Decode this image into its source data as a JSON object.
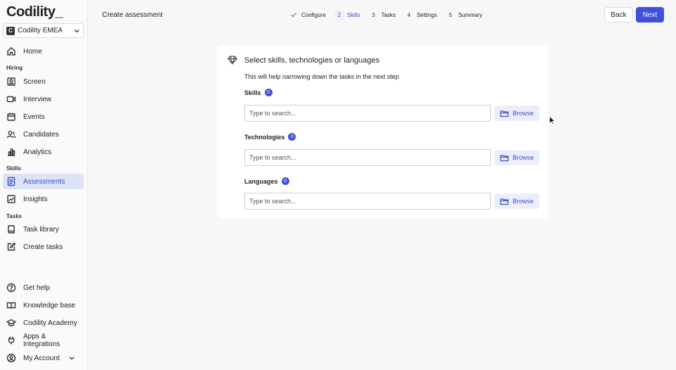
{
  "app": {
    "logo_text": "Codility_"
  },
  "org": {
    "badge": "C",
    "name": "Codility EMEA"
  },
  "nav": {
    "home": "Home",
    "hiring_label": "Hiring",
    "hiring": [
      "Screen",
      "Interview",
      "Events",
      "Candidates",
      "Analytics"
    ],
    "skills_label": "Skills",
    "skills": [
      "Assessments",
      "Insights"
    ],
    "tasks_label": "Tasks",
    "tasks": [
      "Task library",
      "Create tasks"
    ],
    "bottom": [
      "Get help",
      "Knowledge base",
      "Codility Academy",
      "Apps & Integrations",
      "My Account"
    ]
  },
  "header": {
    "title": "Create assessment",
    "steps": [
      {
        "num": "",
        "label": "Configure",
        "state": "done"
      },
      {
        "num": "2",
        "label": "Skills",
        "state": "current"
      },
      {
        "num": "3",
        "label": "Tasks",
        "state": "todo"
      },
      {
        "num": "4",
        "label": "Settings",
        "state": "todo"
      },
      {
        "num": "5",
        "label": "Summary",
        "state": "todo"
      }
    ],
    "back_label": "Back",
    "next_label": "Next"
  },
  "card": {
    "title": "Select skills, technologies or languages",
    "subtitle": "This will help narrowing down the tasks in the next step",
    "fields": [
      {
        "label": "Skills",
        "count": "0",
        "placeholder": "Type to search...",
        "browse_label": "Browse"
      },
      {
        "label": "Technologies",
        "count": "0",
        "placeholder": "Type to search...",
        "browse_label": "Browse"
      },
      {
        "label": "Languages",
        "count": "0",
        "placeholder": "Type to search...",
        "browse_label": "Browse"
      }
    ]
  },
  "colors": {
    "accent": "#3f51d8",
    "active_nav_bg": "#dde2f4"
  }
}
